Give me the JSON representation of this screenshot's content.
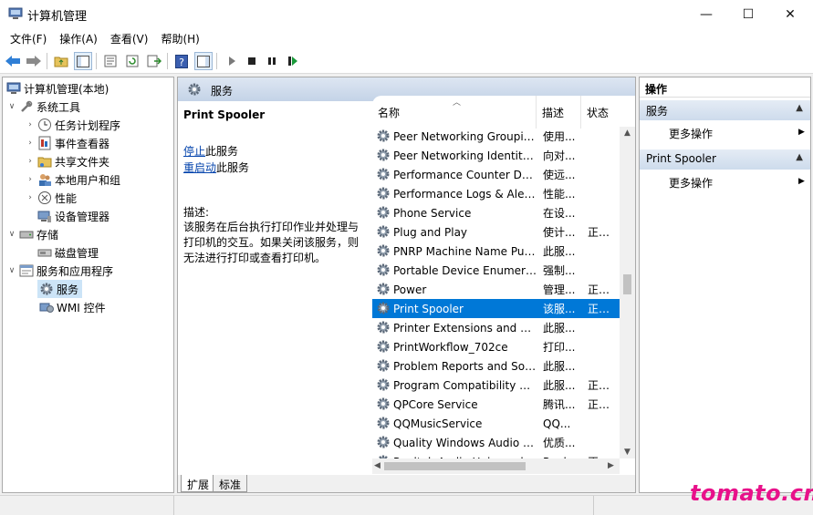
{
  "window": {
    "title": "计算机管理",
    "minimize": "—",
    "maximize": "☐",
    "close": "✕"
  },
  "menu": [
    "文件(F)",
    "操作(A)",
    "查看(V)",
    "帮助(H)"
  ],
  "tree": {
    "items": [
      {
        "label": "计算机管理(本地)",
        "icon": "computer-icon",
        "arrow": ""
      },
      {
        "label": "系统工具",
        "icon": "tools-icon",
        "arrow": "∨"
      },
      {
        "label": "任务计划程序",
        "icon": "clock-icon",
        "arrow": "›"
      },
      {
        "label": "事件查看器",
        "icon": "event-viewer-icon",
        "arrow": "›"
      },
      {
        "label": "共享文件夹",
        "icon": "shared-folder-icon",
        "arrow": "›"
      },
      {
        "label": "本地用户和组",
        "icon": "users-icon",
        "arrow": "›"
      },
      {
        "label": "性能",
        "icon": "performance-icon",
        "arrow": "›"
      },
      {
        "label": "设备管理器",
        "icon": "device-manager-icon",
        "arrow": ""
      },
      {
        "label": "存储",
        "icon": "storage-icon",
        "arrow": "∨"
      },
      {
        "label": "磁盘管理",
        "icon": "disk-icon",
        "arrow": ""
      },
      {
        "label": "服务和应用程序",
        "icon": "services-apps-icon",
        "arrow": "∨"
      },
      {
        "label": "服务",
        "icon": "gear-icon",
        "arrow": ""
      },
      {
        "label": "WMI 控件",
        "icon": "wmi-icon",
        "arrow": ""
      }
    ]
  },
  "services_panel": {
    "header_title": "服务",
    "selected_name": "Print Spooler",
    "stop_link": "停止",
    "stop_suffix": "此服务",
    "restart_link": "重启动",
    "restart_suffix": "此服务",
    "desc_label": "描述:",
    "desc_text": "该服务在后台执行打印作业并处理与打印机的交互。如果关闭该服务，则无法进行打印或查看打印机。",
    "columns": {
      "name": "名称",
      "desc": "描述",
      "status": "状态"
    },
    "rows": [
      {
        "name": "Peer Networking Grouping",
        "desc": "使用...",
        "status": ""
      },
      {
        "name": "Peer Networking Identity Manager",
        "desc": "向对...",
        "status": ""
      },
      {
        "name": "Performance Counter DLL Host",
        "desc": "使远...",
        "status": ""
      },
      {
        "name": "Performance Logs & Alerts",
        "desc": "性能...",
        "status": ""
      },
      {
        "name": "Phone Service",
        "desc": "在设...",
        "status": ""
      },
      {
        "name": "Plug and Play",
        "desc": "使计...",
        "status": "正在..."
      },
      {
        "name": "PNRP Machine Name Publication Service",
        "desc": "此服...",
        "status": ""
      },
      {
        "name": "Portable Device Enumerator Service",
        "desc": "强制...",
        "status": ""
      },
      {
        "name": "Power",
        "desc": "管理...",
        "status": "正在..."
      },
      {
        "name": "Print Spooler",
        "desc": "该服...",
        "status": "正在..."
      },
      {
        "name": "Printer Extensions and Notifications",
        "desc": "此服...",
        "status": ""
      },
      {
        "name": "PrintWorkflow_702ce",
        "desc": "打印...",
        "status": ""
      },
      {
        "name": "Problem Reports and Solutions Control Panel Support",
        "desc": "此服...",
        "status": ""
      },
      {
        "name": "Program Compatibility Assistant Service",
        "desc": "此服...",
        "status": "正在..."
      },
      {
        "name": "QPCore Service",
        "desc": "腾讯...",
        "status": "正在..."
      },
      {
        "name": "QQMusicService",
        "desc": "QQ...",
        "status": ""
      },
      {
        "name": "Quality Windows Audio Video Experience",
        "desc": "优质...",
        "status": ""
      },
      {
        "name": "Realtek Audio Universal Service",
        "desc": "Realt...",
        "status": "正在..."
      }
    ],
    "selected_index": 9,
    "tabs": {
      "extended": "扩展",
      "standard": "标准"
    }
  },
  "actions": {
    "title": "操作",
    "sections": [
      {
        "header": "服务",
        "item": "更多操作"
      },
      {
        "header": "Print Spooler",
        "item": "更多操作"
      }
    ]
  },
  "watermark": "tomato.cm",
  "colors": {
    "selection": "#0078d7",
    "link": "#0645ad",
    "watermark": "#e8118a",
    "header_gradient_top": "#dde6f2"
  }
}
